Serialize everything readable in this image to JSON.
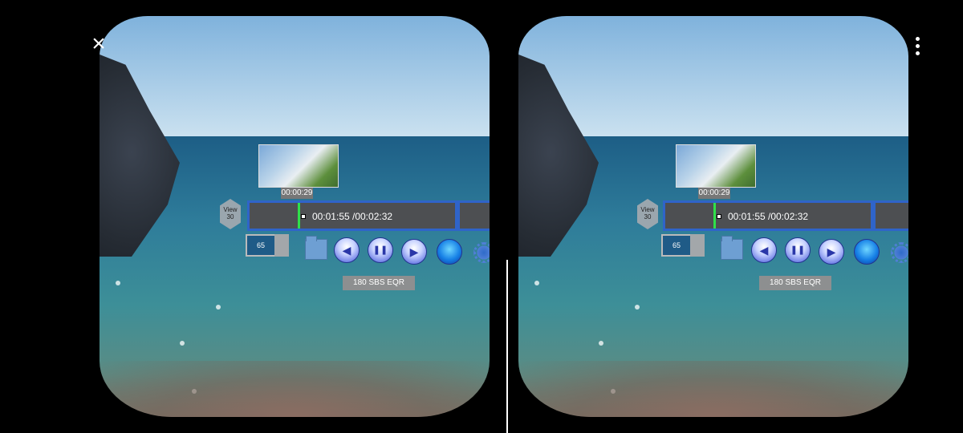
{
  "controls": {
    "close_icon": "×",
    "menu_icon": "vertical-dots"
  },
  "player": {
    "thumbnail_time": "00:00:29",
    "view_label": "View",
    "view_value": "30",
    "time_display": "00:01:55 /00:02:32",
    "progress_fraction": 0.1,
    "volume_value": "65",
    "mode_label": "180 SBS EQR"
  },
  "icons": {
    "prev": "◀",
    "pause": "❚❚",
    "play": "▶"
  },
  "colors": {
    "timeline_border": "#2f64c9",
    "progress_marker": "#2fe04a"
  }
}
